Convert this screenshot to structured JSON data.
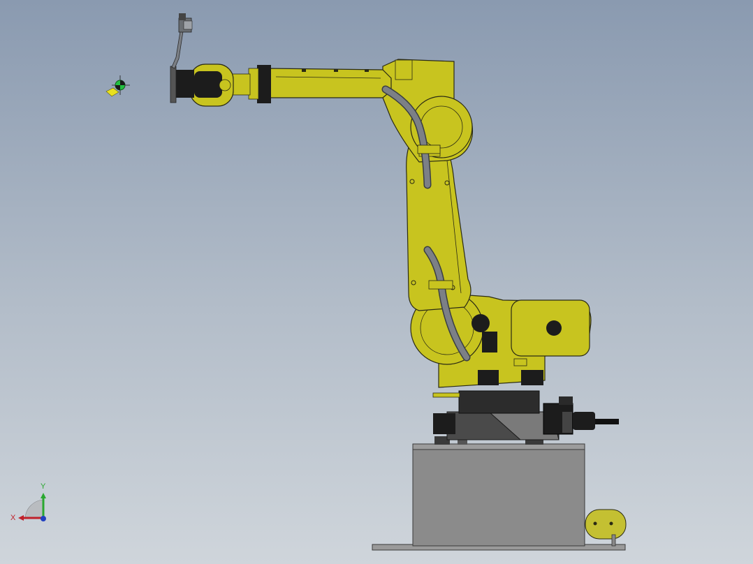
{
  "viewport": {
    "background_top": "#8a9ab0",
    "background_bottom": "#cfd5db"
  },
  "colors": {
    "robot_yellow": "#c8c41f",
    "robot_yellow_dark": "#8f8c12",
    "robot_outline": "#2a2a14",
    "cable_gray": "#777b80",
    "base_gray": "#8a8a8a",
    "base_outline": "#3a3a3a",
    "motor_black": "#1c1c1c",
    "axis_x": "#c0202a",
    "axis_y": "#2aa830",
    "axis_z": "#2040c0"
  },
  "triad": {
    "x_label": "X",
    "y_label": "Y"
  },
  "icons": {
    "origin_marker": "origin-marker-icon",
    "triad": "coordinate-triad-icon"
  }
}
